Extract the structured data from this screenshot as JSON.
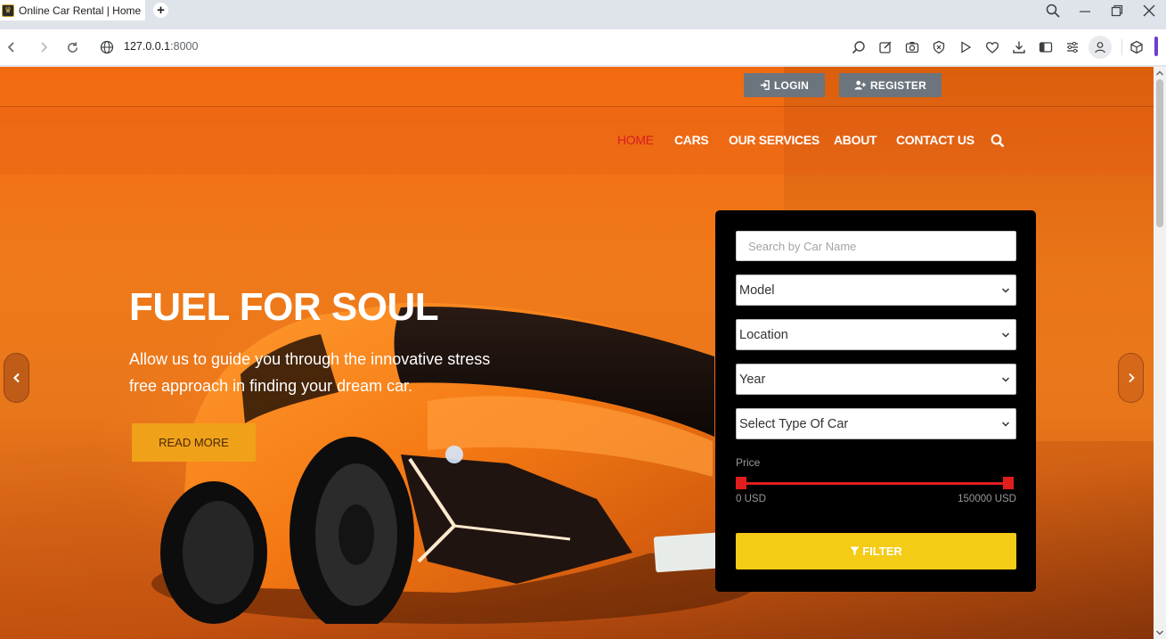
{
  "browser": {
    "tab_title": "Online Car Rental | Home",
    "url_host": "127.0.0.1",
    "url_port": ":8000"
  },
  "header": {
    "login_label": "LOGIN",
    "register_label": "REGISTER"
  },
  "nav": {
    "items": [
      {
        "label": "HOME",
        "active": true
      },
      {
        "label": "CARS",
        "active": false
      },
      {
        "label": "OUR SERVICES",
        "active": false
      },
      {
        "label": "ABOUT",
        "active": false
      },
      {
        "label": "CONTACT US",
        "active": false
      }
    ]
  },
  "hero": {
    "title": "FUEL FOR SOUL",
    "subtitle": "Allow us to guide you through the innovative stress free approach in finding your dream car.",
    "cta_label": "READ MORE"
  },
  "filter": {
    "search_placeholder": "Search by Car Name",
    "model_selected": "Model",
    "location_selected": "Location",
    "year_selected": "Year",
    "type_selected": "Select Type Of Car",
    "price_label": "Price",
    "price_min": "0 USD",
    "price_max": "150000 USD",
    "button_label": "FILTER"
  },
  "colors": {
    "accent_red": "#d61f1f",
    "cta_orange": "#f0a11a",
    "filter_yellow": "#f4cb15",
    "panel_black": "#000000",
    "top_button_gray": "#6c757d"
  }
}
